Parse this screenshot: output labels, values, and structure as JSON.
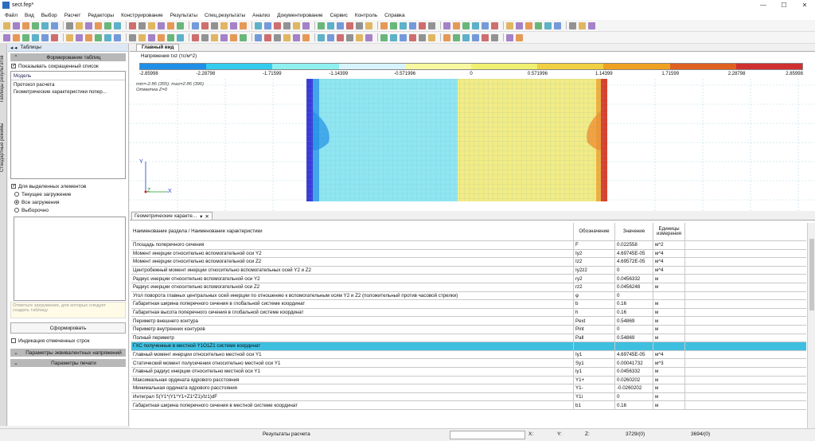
{
  "window": {
    "title": "sect.fep*",
    "min": "—",
    "max": "☐",
    "close": "✕"
  },
  "menu": [
    "Файл",
    "Вид",
    "Выбор",
    "Расчет",
    "Редакторы",
    "Конструирование",
    "Результаты",
    "Спец.результаты",
    "Анализ",
    "Документирование",
    "Сервис",
    "Контроль",
    "Справка"
  ],
  "left_vtabs": [
    "Стандартные режимы",
    "Таблицы результатов"
  ],
  "panel": {
    "header": "Таблицы",
    "section_title": "Формирование таблиц",
    "short_list_label": "Показывать сокращенный список",
    "tree_header": "Модель",
    "tree_items": [
      "Протокол расчета",
      "Геометрические характеристики попер..."
    ],
    "selected_elements_label": "Для выделенных элементов",
    "radios": [
      "Текущее загружение",
      "Все загружения",
      "Выборочно"
    ],
    "hint": "Отметьте загружения, для которых следует создать таблицу",
    "build_button": "Сформировать",
    "mark_rows_label": "Индикация отмеченных строк",
    "section2": "Параметры эквивалентных напряжений",
    "section3": "Параметры печати"
  },
  "view": {
    "tab": "Главный вид",
    "scale_title": "Напряжения τxz (тс/м^2)",
    "scale_labels": [
      "-2.85998",
      "-2.28798",
      "-1.71599",
      "-1.14399",
      "-0.571996",
      "0",
      "0.571996",
      "1.14399",
      "1.71599",
      "2.28798",
      "2.85998"
    ],
    "scale_colors": [
      "#3030d0",
      "#1f8fe8",
      "#33ccf0",
      "#8ff0f0",
      "#d8f4ff",
      "#f8f8a0",
      "#f0f070",
      "#f0d040",
      "#f0a020",
      "#e06020",
      "#d03030"
    ],
    "minmax_line1": "min=-2.86 (355); max=2.86 (396)",
    "minmax_line2": "Отметка Z=0",
    "axis_y": "Y",
    "axis_z": "Z",
    "axis_x": "X"
  },
  "table": {
    "tab_title": "Геометрические характе...",
    "headers": [
      "Наименование раздела / Наименование характеристики",
      "Обозначение",
      "Значение",
      "Единицы измерения"
    ],
    "rows": [
      [
        "Площадь поперечного сечения",
        "F",
        "0.022558",
        "м^2"
      ],
      [
        "Момент инерции относительно вспомогательной оси Y2",
        "Iy2",
        "4.69745E-05",
        "м^4"
      ],
      [
        "Момент инерции относительно вспомогательной оси Z2",
        "Iz2",
        "4.69572E-05",
        "м^4"
      ],
      [
        "Центробежный момент инерции относительно вспомогательных осей Y2 и Z2",
        "Iy2z2",
        "0",
        "м^4"
      ],
      [
        "Радиус инерции относительно вспомогательной оси Y2",
        "ry2",
        "0.0456332",
        "м"
      ],
      [
        "Радиус инерции относительно вспомогательной оси Z2",
        "rz2",
        "0.0456248",
        "м"
      ],
      [
        "Угол поворота главных центральных осей инерции по отношению к вспомогательным осям Y2 и Z2 (положительный против часовой стрелки)",
        "φ",
        "0",
        ""
      ],
      [
        "Габаритная ширина поперечного сечения в глобальной системе координат",
        "b",
        "0.16",
        "м"
      ],
      [
        "Габаритная высота поперечного сечения в глобальной системе координат",
        "h",
        "0.16",
        "м"
      ],
      [
        "Периметр внешнего контура",
        "Pext",
        "0.54869",
        "м"
      ],
      [
        "Периметр внутренних контуров",
        "Pint",
        "0",
        "м"
      ],
      [
        "Полный периметр",
        "Pall",
        "0.54869",
        "м"
      ],
      [
        "ГХС полученные в местной Y1O1Z1 системе координат",
        "",
        "",
        ""
      ],
      [
        "Главный момент инерции относительно местной оси Y1",
        "Iy1",
        "4.69745E-05",
        "м^4"
      ],
      [
        "Статический момент полусечения относительно местной оси Y1",
        "Sy1",
        "0.00041732",
        "м^3"
      ],
      [
        "Главный радиус инерции относительно местной оси Y1",
        "iy1",
        "0.0456332",
        "м"
      ],
      [
        "Максимальная ордината ядрового расстояния",
        "Y1+",
        "0.0260202",
        "м"
      ],
      [
        "Минимальная ордината ядрового расстояния",
        "Y1-",
        "-0.0260202",
        "м"
      ],
      [
        "Интеграл S(Y1*(Y1*Y1+Z1*Z1)/Iz1)dF",
        "Y1i",
        "0",
        "м"
      ],
      [
        "Габаритная ширина поперечного сечения в местной системе координат",
        "b1",
        "0.16",
        "м"
      ]
    ]
  },
  "status": {
    "message": "Результаты расчета",
    "x_label": "X:",
    "y_label": "Y:",
    "z_label": "Z:",
    "count1": "3729/(0)",
    "count2": "3694/(0)"
  }
}
